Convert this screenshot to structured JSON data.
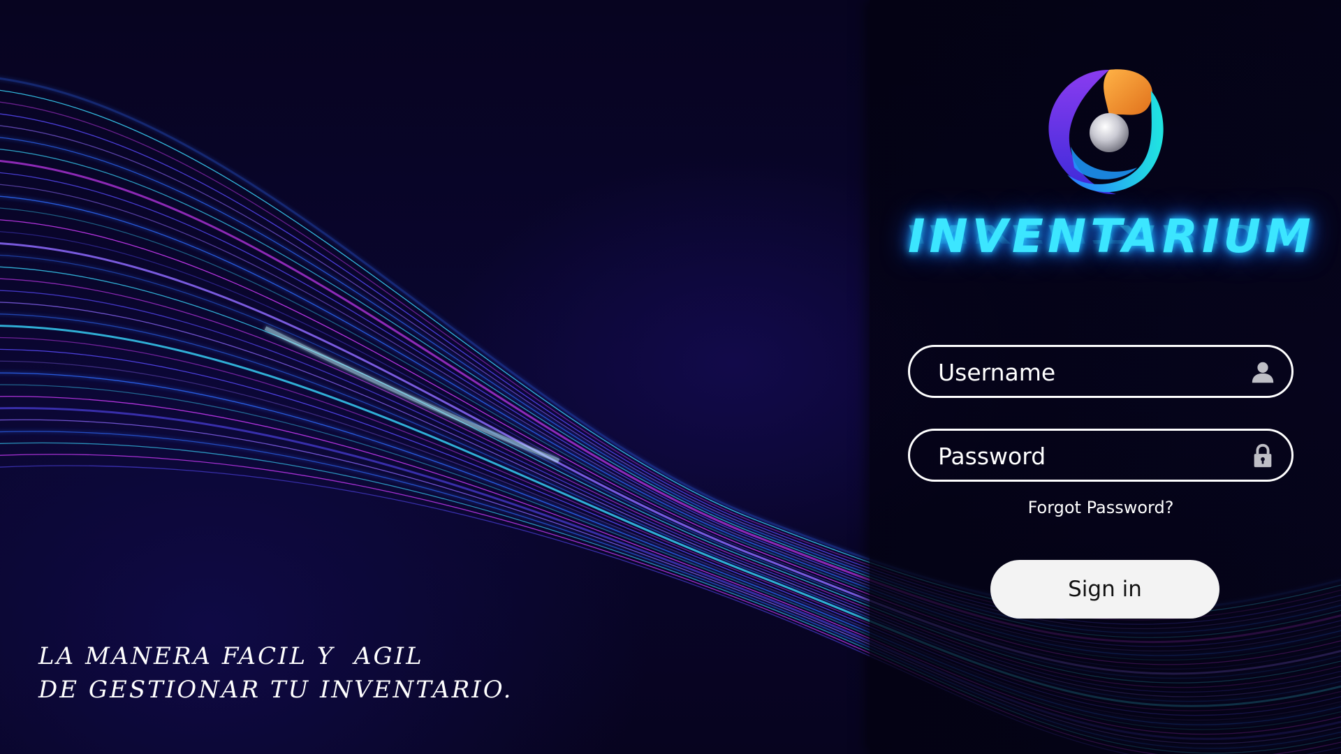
{
  "brand": {
    "name": "INVENTARIUM",
    "accent_color": "#3ce6ff",
    "logo_icon": "swirl-sphere-logo-icon"
  },
  "login": {
    "username_placeholder": "Username",
    "username_icon": "user-icon",
    "password_placeholder": "Password",
    "password_icon": "lock-icon",
    "forgot_label": "Forgot Password?",
    "signin_label": "Sign in"
  },
  "tagline": {
    "line1": "LA MANERA FACIL Y  AGIL",
    "line2": "DE GESTIONAR TU INVENTARIO."
  },
  "colors": {
    "background": "#07041f",
    "wave_blue": "#2f6bff",
    "wave_cyan": "#3ad8ff",
    "wave_magenta": "#d23cff",
    "button_bg": "#f3f3f3"
  }
}
